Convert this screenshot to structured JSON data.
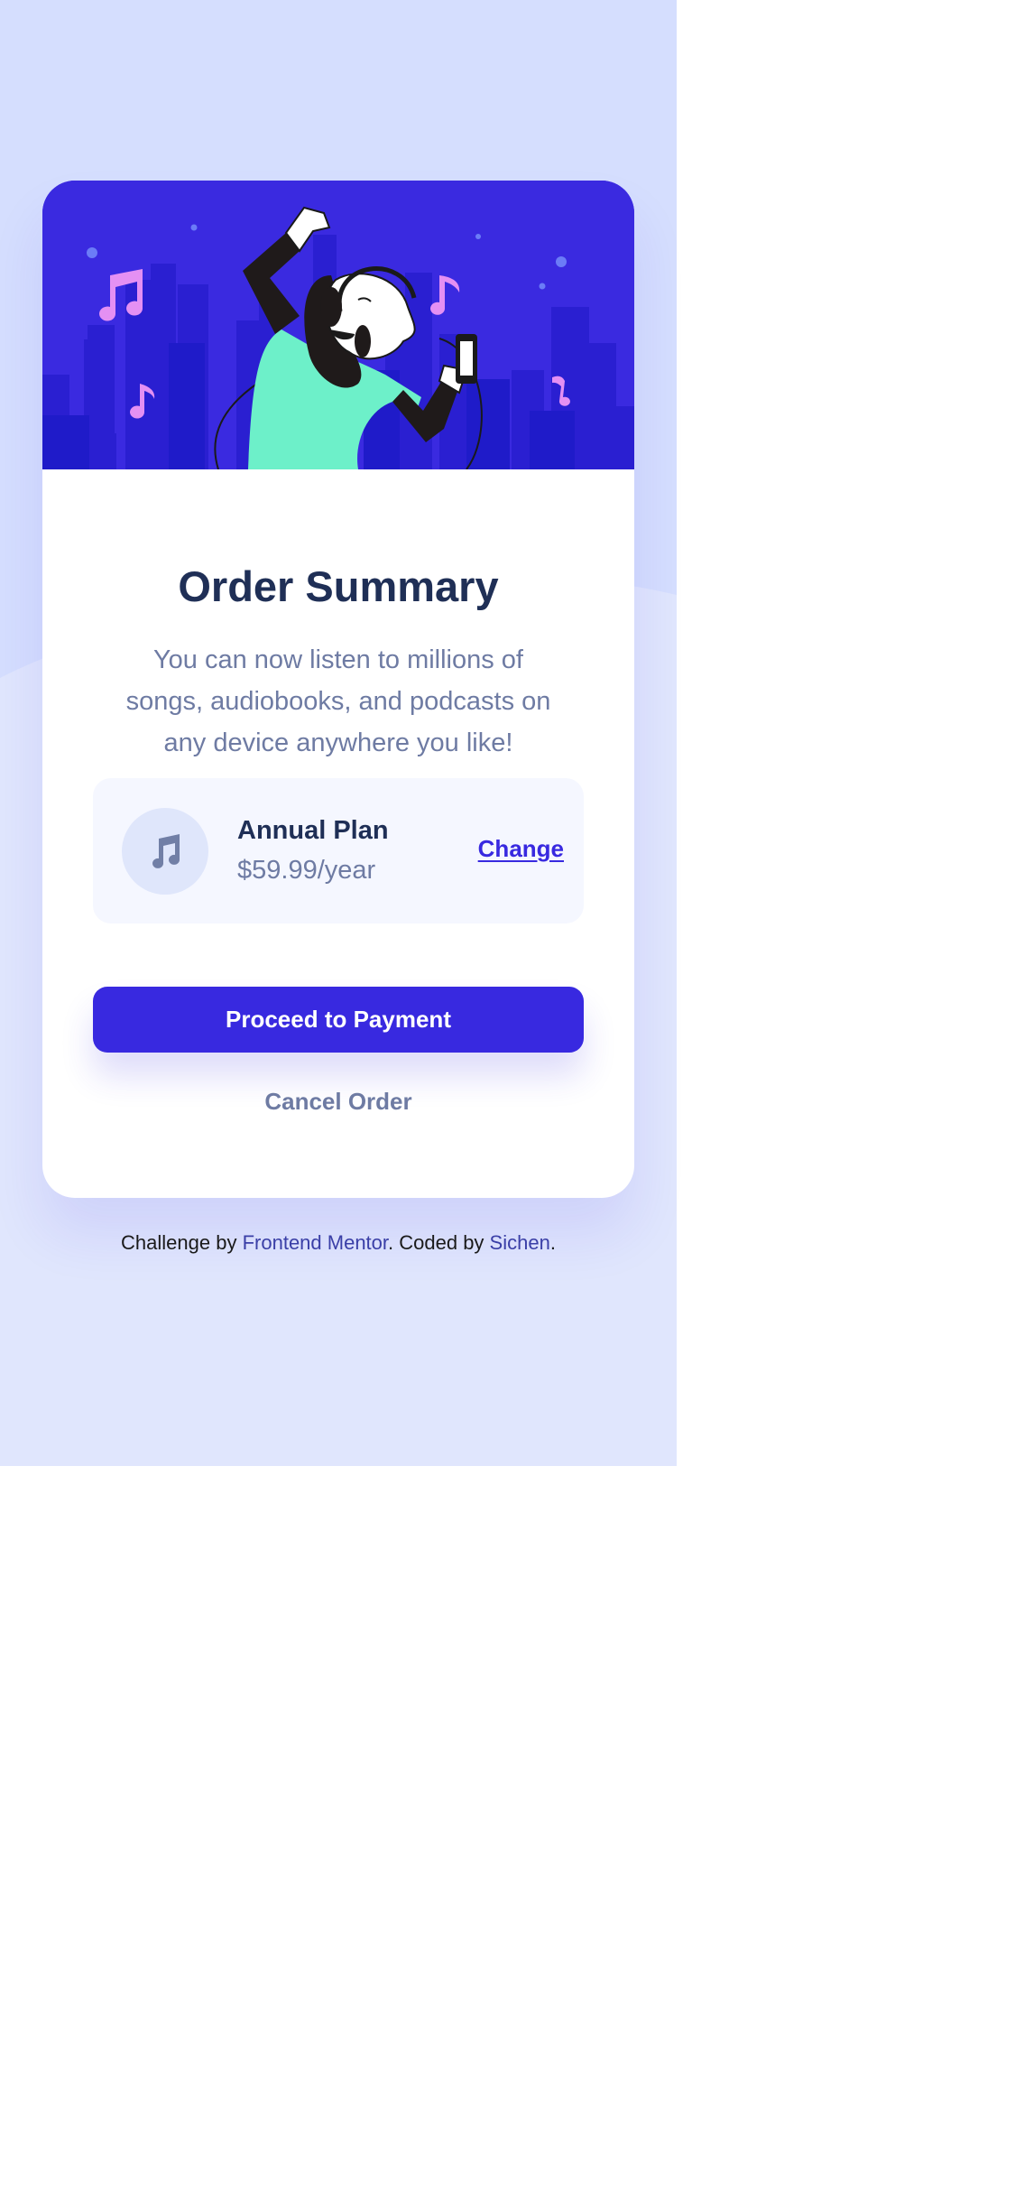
{
  "colors": {
    "background": "#d5defe",
    "background_lower": "#e0e6fd",
    "hero_background": "#3a2ae0",
    "accent": "#3829e0",
    "title_text": "#1f2f56",
    "muted_text": "#6e7ba3",
    "plan_panel": "#f5f7ff"
  },
  "card": {
    "title": "Order Summary",
    "description": "You can now listen to millions of songs, audiobooks, and podcasts on any device anywhere you like!",
    "hero_illustration": "person-dancing-with-headphones-illustration"
  },
  "plan": {
    "icon": "music-note-icon",
    "name": "Annual Plan",
    "price": "$59.99/year",
    "change_label": "Change"
  },
  "actions": {
    "proceed_label": "Proceed to Payment",
    "cancel_label": "Cancel Order"
  },
  "footer": {
    "prefix": "Challenge by ",
    "link1": "Frontend Mentor",
    "middle": ". Coded by ",
    "link2": "Sichen",
    "suffix": "."
  }
}
